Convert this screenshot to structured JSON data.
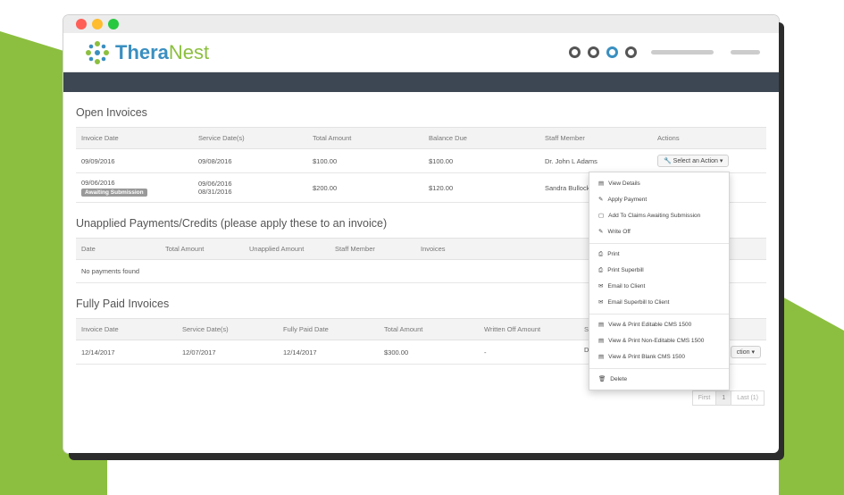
{
  "colors": {
    "brand_green": "#8cbf3f",
    "brand_blue": "#3a8fc0",
    "nav": "#3d4753",
    "badge": "#999999"
  },
  "app": {
    "logo_text_a": "Thera",
    "logo_text_b": "Nest"
  },
  "open_invoices": {
    "title": "Open Invoices",
    "headers": [
      "Invoice Date",
      "Service Date(s)",
      "Total Amount",
      "Balance Due",
      "Staff Member",
      "Actions"
    ],
    "rows": [
      {
        "invoice_date": "09/09/2016",
        "service_dates": [
          "09/08/2016"
        ],
        "total": "$100.00",
        "balance": "$100.00",
        "staff": "Dr. John L Adams",
        "action": "Select an Action"
      },
      {
        "invoice_date": "09/06/2016",
        "badge": "Awaiting Submission",
        "service_dates": [
          "09/06/2016",
          "08/31/2016"
        ],
        "total": "$200.00",
        "balance": "$120.00",
        "staff": "Sandra Bullock"
      }
    ]
  },
  "unapplied": {
    "title": "Unapplied Payments/Credits (please apply these to an invoice)",
    "headers": [
      "Date",
      "Total Amount",
      "Unapplied Amount",
      "Staff Member",
      "Invoices"
    ],
    "empty": "No payments found"
  },
  "fully_paid": {
    "title": "Fully Paid Invoices",
    "headers": [
      "Invoice Date",
      "Service Date(s)",
      "Fully Paid Date",
      "Total Amount",
      "Written Off Amount",
      "St"
    ],
    "rows": [
      {
        "invoice_date": "12/14/2017",
        "service_dates": "12/07/2017",
        "paid_date": "12/14/2017",
        "total": "$300.00",
        "written_off": "-",
        "staff": "D",
        "action": "ction"
      }
    ]
  },
  "pager": {
    "first": "First",
    "page": "1",
    "last": "Last (1)"
  },
  "dropdown": {
    "group1": [
      "View Details",
      "Apply Payment",
      "Add To Claims Awaiting Submission",
      "Write Off"
    ],
    "group2": [
      "Print",
      "Print Superbill",
      "Email to Client",
      "Email Superbill to Client"
    ],
    "group3": [
      "View & Print Editable CMS 1500",
      "View & Print Non-Editable CMS 1500",
      "View & Print Blank CMS 1500"
    ],
    "group4": [
      "Delete"
    ]
  }
}
